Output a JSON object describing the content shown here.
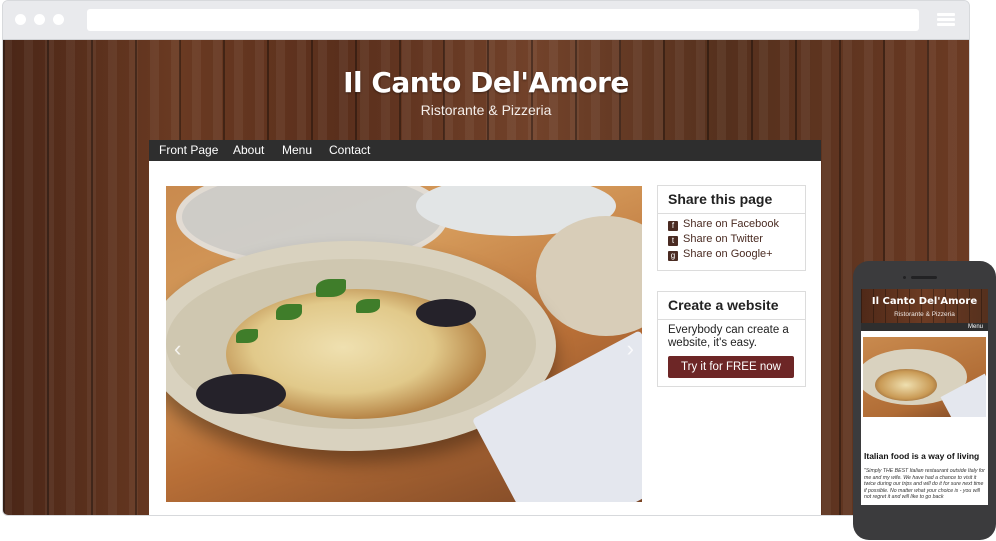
{
  "site": {
    "title": "Il Canto Del'Amore",
    "subtitle": "Ristorante & Pizzeria"
  },
  "nav": {
    "items": [
      "Front Page",
      "About",
      "Menu",
      "Contact"
    ]
  },
  "share_widget": {
    "title": "Share this page",
    "links": [
      {
        "label": "Share on Facebook",
        "icon": "facebook-icon",
        "glyph": "f"
      },
      {
        "label": "Share on Twitter",
        "icon": "twitter-icon",
        "glyph": "t"
      },
      {
        "label": "Share on Google+",
        "icon": "google-plus-icon",
        "glyph": "g"
      }
    ]
  },
  "create_widget": {
    "title": "Create a website",
    "text": "Everybody can create a website, it's easy.",
    "button": "Try it for FREE now"
  },
  "slider": {
    "prev": "‹",
    "next": "›"
  },
  "mobile": {
    "title": "Il Canto Del'Amore",
    "subtitle": "Ristorante & Pizzeria",
    "menu_label": "Menu",
    "heading": "Italian food is a way of living",
    "quote": "\"Simply THE BEST Italian restaurant outside Italy for me and my wife. We have had a chance to visit it twice during our trips and will do it for sure next time if possible. No matter what your choice is - you will not regret it and will like to go back"
  },
  "colors": {
    "nav_bg": "#2e2e2e",
    "cta_bg": "#6d2626",
    "link_color": "#4a2b22"
  }
}
